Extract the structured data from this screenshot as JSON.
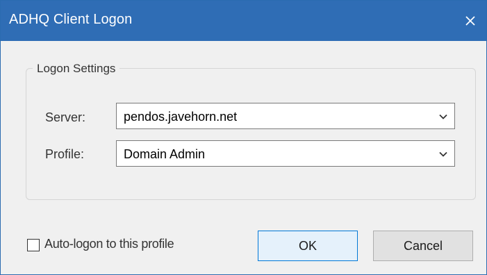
{
  "window": {
    "title": "ADHQ Client Logon",
    "close_icon": "close-icon"
  },
  "group": {
    "legend": "Logon Settings"
  },
  "server": {
    "label": "Server:",
    "value": "pendos.javehorn.net",
    "arrow_icon": "chevron-down-icon"
  },
  "profile": {
    "label": "Profile:",
    "value": "Domain Admin",
    "arrow_icon": "chevron-down-icon"
  },
  "auto_logon": {
    "label": "Auto-logon to this profile",
    "checked": false
  },
  "buttons": {
    "ok": "OK",
    "cancel": "Cancel"
  },
  "colors": {
    "titlebar": "#2f6db5",
    "dialog_bg": "#f0f0f0",
    "default_button_border": "#0078d7"
  }
}
